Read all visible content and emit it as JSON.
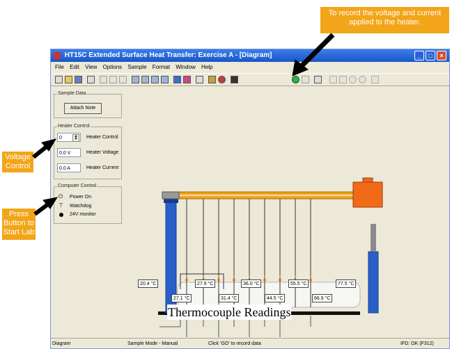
{
  "callouts": {
    "top": "To record the voltage and current applied to the heater.",
    "voltage": "Voltage Control",
    "press": "Press Button to Start Lab"
  },
  "window": {
    "title": "HT15C Extended Surface Heat Transfer:  Exercise A - [Diagram]"
  },
  "menu": [
    "File",
    "Edit",
    "View",
    "Options",
    "Sample",
    "Format",
    "Window",
    "Help"
  ],
  "sample_data": {
    "group_label": "Sample Data",
    "attach_note": "Attach Note"
  },
  "heater_control": {
    "group_label": "Heater Control",
    "heater_control_value": "0",
    "heater_control_label": "Heater Control",
    "heater_voltage_value": "0.0 V",
    "heater_voltage_label": "Heater Voltage",
    "heater_current_value": "0.0 A",
    "heater_current_label": "Heater Current"
  },
  "computer_control": {
    "group_label": "Computer Control",
    "power_on": "Power On",
    "watchdog": "Watchdog",
    "monitor_24v": "24V monitor"
  },
  "thermocouples": {
    "top_row": [
      "20.4 °C",
      "27.9 °C",
      "36.0 °C",
      "55.5 °C",
      "77.5 °C"
    ],
    "bottom_row": [
      "27.1 °C",
      "31.4 °C",
      "44.5 °C",
      "66.9 °C"
    ],
    "caption": "Thermocouple Readings"
  },
  "status": {
    "left": "Diagram",
    "mode": "Sample Mode - Manual",
    "hint": "Click 'GO' to record data",
    "ifd": "IFD: OK (F312)"
  },
  "colors": {
    "callout": "#f3a519",
    "title_bar": "#1656c8",
    "rod": "#f0a020",
    "pillar": "#2a5fc8",
    "heater_block": "#f06a18"
  },
  "icons": {
    "go_button": "go-record-icon",
    "window_close": "close-icon",
    "window_maximize": "maximize-icon",
    "window_minimize": "minimize-icon"
  }
}
